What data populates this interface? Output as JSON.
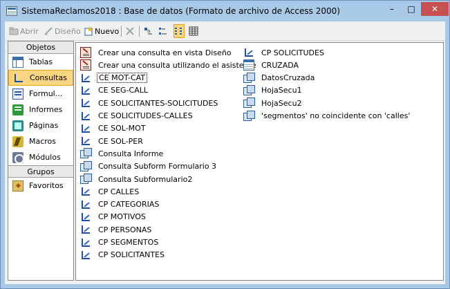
{
  "window": {
    "title": "SistemaReclamos2018 : Base de datos (Formato de archivo de Access 2000)",
    "minimize": "–",
    "maximize": "□",
    "close": "✕"
  },
  "toolbar": {
    "open_label": "Abrir",
    "design_label": "Diseño",
    "new_label": "Nuevo"
  },
  "sidebar": {
    "objects_header": "Objetos",
    "items": [
      {
        "label": "Tablas",
        "icon": "table-icon"
      },
      {
        "label": "Consultas",
        "icon": "query-icon",
        "selected": true
      },
      {
        "label": "Formul...",
        "icon": "form-icon"
      },
      {
        "label": "Informes",
        "icon": "report-icon"
      },
      {
        "label": "Páginas",
        "icon": "page-icon"
      },
      {
        "label": "Macros",
        "icon": "macro-icon"
      },
      {
        "label": "Módulos",
        "icon": "module-icon"
      }
    ],
    "groups_header": "Grupos",
    "groups": [
      {
        "label": "Favoritos",
        "icon": "favorites-icon"
      }
    ]
  },
  "queries": {
    "column1": [
      {
        "label": "Crear una consulta en vista Diseño",
        "icon": "design-wizard-icon"
      },
      {
        "label": "Crear una consulta utilizando el asistente",
        "icon": "design-wizard-icon"
      },
      {
        "label": "CE MOT-CAT",
        "icon": "select-query-icon",
        "focused": true
      },
      {
        "label": "CE SEG-CALL",
        "icon": "select-query-icon"
      },
      {
        "label": "CE SOLICITANTES-SOLICITUDES",
        "icon": "select-query-icon"
      },
      {
        "label": "CE SOLICITUDES-CALLES",
        "icon": "select-query-icon"
      },
      {
        "label": "CE SOL-MOT",
        "icon": "select-query-icon"
      },
      {
        "label": "CE SOL-PER",
        "icon": "select-query-icon"
      },
      {
        "label": "Consulta Informe",
        "icon": "sql-query-icon"
      },
      {
        "label": "Consulta Subform Formulario 3",
        "icon": "sql-query-icon"
      },
      {
        "label": "Consulta Subformulario2",
        "icon": "sql-query-icon"
      },
      {
        "label": "CP CALLES",
        "icon": "select-query-icon"
      },
      {
        "label": "CP CATEGORIAS",
        "icon": "select-query-icon"
      },
      {
        "label": "CP MOTIVOS",
        "icon": "select-query-icon"
      },
      {
        "label": "CP PERSONAS",
        "icon": "select-query-icon"
      },
      {
        "label": "CP SEGMENTOS",
        "icon": "select-query-icon"
      },
      {
        "label": "CP SOLICITANTES",
        "icon": "select-query-icon"
      }
    ],
    "column2": [
      {
        "label": "CP SOLICITUDES",
        "icon": "select-query-icon"
      },
      {
        "label": "CRUZADA",
        "icon": "crosstab-query-icon"
      },
      {
        "label": "DatosCruzada",
        "icon": "sql-query-icon"
      },
      {
        "label": "HojaSecu1",
        "icon": "sql-query-icon"
      },
      {
        "label": "HojaSecu2",
        "icon": "sql-query-icon"
      },
      {
        "label": "'segmentos' no coincidente con 'calles'",
        "icon": "sql-query-icon"
      }
    ]
  }
}
